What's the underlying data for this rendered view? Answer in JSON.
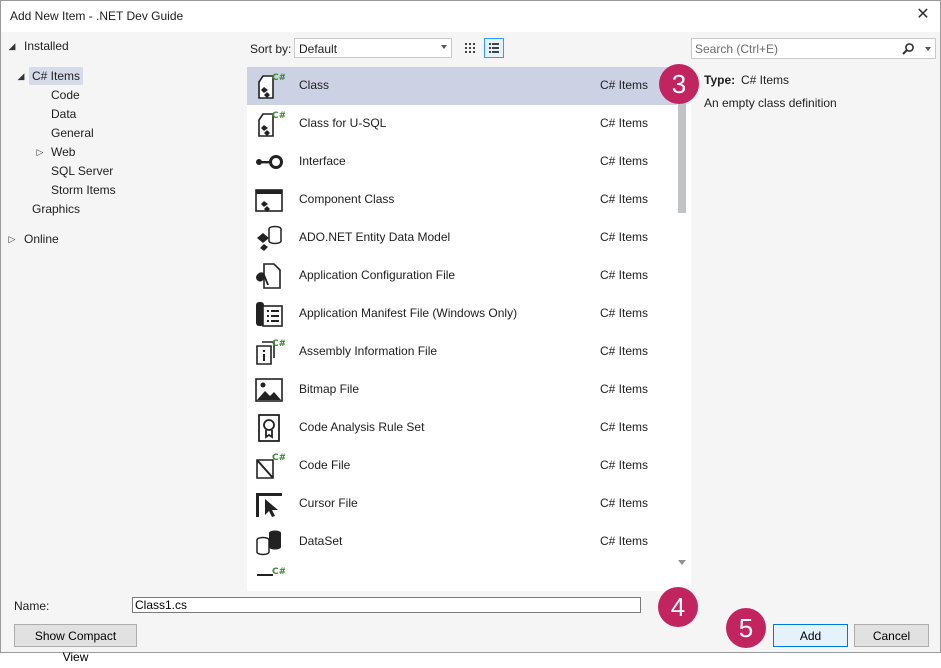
{
  "window": {
    "title": "Add New Item - .NET Dev Guide",
    "close_glyph": "✕"
  },
  "tree": {
    "installed": "Installed",
    "csharp_items": "C# Items",
    "code": "Code",
    "data": "Data",
    "general": "General",
    "web": "Web",
    "sql_server": "SQL Server",
    "storm_items": "Storm Items",
    "graphics": "Graphics",
    "online": "Online"
  },
  "toolbar": {
    "sort_label": "Sort by:",
    "sort_value": "Default",
    "search_placeholder": "Search (Ctrl+E)",
    "active_view": "list"
  },
  "items": [
    {
      "name": "Class",
      "category": "C# Items",
      "icon": "class-icon",
      "selected": true
    },
    {
      "name": "Class for U-SQL",
      "category": "C# Items",
      "icon": "usql-class-icon"
    },
    {
      "name": "Interface",
      "category": "C# Items",
      "icon": "interface-icon"
    },
    {
      "name": "Component Class",
      "category": "C# Items",
      "icon": "component-class-icon"
    },
    {
      "name": "ADO.NET Entity Data Model",
      "category": "C# Items",
      "icon": "entity-data-model-icon"
    },
    {
      "name": "Application Configuration File",
      "category": "C# Items",
      "icon": "config-file-icon"
    },
    {
      "name": "Application Manifest File (Windows Only)",
      "category": "C# Items",
      "icon": "manifest-file-icon"
    },
    {
      "name": "Assembly Information File",
      "category": "C# Items",
      "icon": "assembly-info-icon"
    },
    {
      "name": "Bitmap File",
      "category": "C# Items",
      "icon": "bitmap-file-icon"
    },
    {
      "name": "Code Analysis Rule Set",
      "category": "C# Items",
      "icon": "rule-set-icon"
    },
    {
      "name": "Code File",
      "category": "C# Items",
      "icon": "code-file-icon"
    },
    {
      "name": "Cursor File",
      "category": "C# Items",
      "icon": "cursor-file-icon"
    },
    {
      "name": "DataSet",
      "category": "C# Items",
      "icon": "dataset-icon"
    }
  ],
  "details": {
    "type_label": "Type:",
    "type_value": "C# Items",
    "description": "An empty class definition"
  },
  "callouts": [
    "3",
    "4",
    "5"
  ],
  "footer": {
    "name_label": "Name:",
    "name_value": "Class1.cs",
    "compact_view": "Show Compact View",
    "add": "Add",
    "cancel": "Cancel"
  },
  "colors": {
    "accent_callout": "#c1245f",
    "selection": "#cdd1e4",
    "default_button_border": "#0078d7"
  }
}
